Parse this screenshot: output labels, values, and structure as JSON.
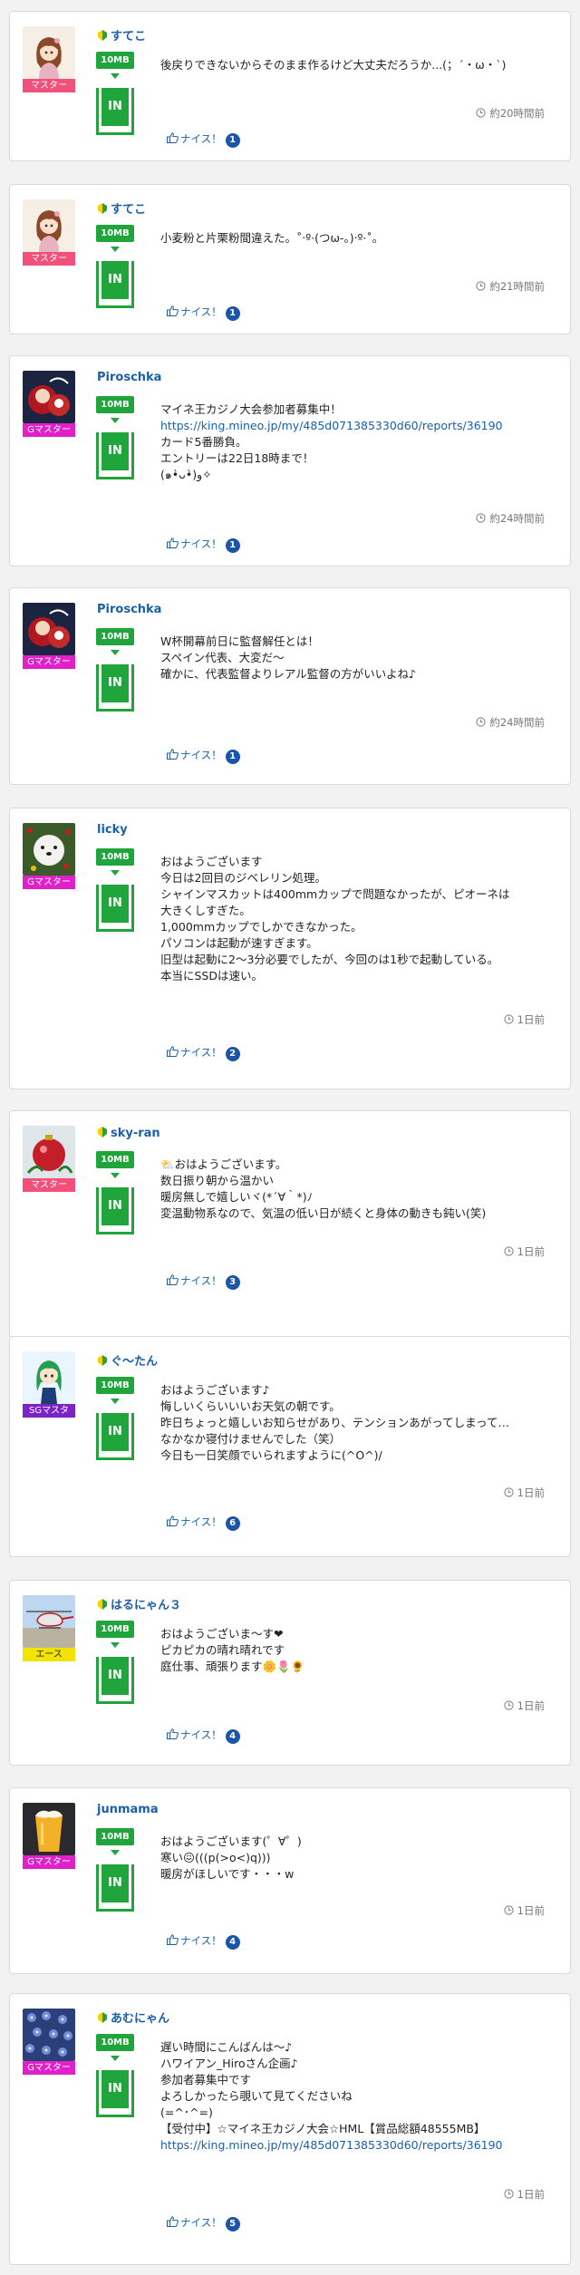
{
  "colors": {
    "accent_green": "#1fa53b",
    "link_blue": "#1a5fa8",
    "badge_blue": "#1a56a8",
    "rank_master": "#f0507a",
    "rank_gmaster": "#e020c8",
    "rank_sgmaster": "#7a24c8",
    "rank_ace": "#f2e400"
  },
  "common": {
    "mb_label": "10MB",
    "in_label": "IN",
    "nice_label": "ナイス！"
  },
  "posts": [
    {
      "user": "すてこ",
      "beginner": true,
      "rank": "マスター",
      "rank_color": "#f0507a",
      "avatar": "girl-illustration",
      "lines": [
        "後戻りできないからそのまま作るけど大丈夫だろうか...(；´・ω・`)"
      ],
      "time": "約20時間前",
      "nice_count": "1"
    },
    {
      "user": "すてこ",
      "beginner": true,
      "rank": "マスター",
      "rank_color": "#f0507a",
      "avatar": "girl-illustration",
      "lines": [
        "小麦粉と片栗粉間違えた。˚‧º·(つω-｡)‧º·˚。"
      ],
      "time": "約21時間前",
      "nice_count": "1"
    },
    {
      "user": "Piroschka",
      "beginner": false,
      "rank": "Gマスター",
      "rank_color": "#e020c8",
      "avatar": "red-character",
      "lines": [
        "マイネ王カジノ大会参加者募集中！",
        "https://king.mineo.jp/my/485d071385330d60/reports/36190",
        "カード5番勝負。",
        "エントリーは22日18時まで！",
        "(๑•̀ᴗ•̀)ﻭ✧"
      ],
      "link_index": 1,
      "time": "約24時間前",
      "nice_count": "1"
    },
    {
      "user": "Piroschka",
      "beginner": false,
      "rank": "Gマスター",
      "rank_color": "#e020c8",
      "avatar": "red-character",
      "lines": [
        "W杯開幕前日に監督解任とは！",
        "スペイン代表、大変だ〜",
        "確かに、代表監督よりレアル監督の方がいいよね♪"
      ],
      "time": "約24時間前",
      "nice_count": "1"
    },
    {
      "user": "licky",
      "beginner": false,
      "rank": "Gマスター",
      "rank_color": "#e020c8",
      "avatar": "white-dog",
      "lines": [
        "おはようございます",
        "今日は2回目のジベレリン処理。",
        "シャインマスカットは400mmカップで問題なかったが、ピオーネは",
        "大きくしすぎた。",
        "1,000mmカップでしかできなかった。",
        "パソコンは起動が速すぎます。",
        "旧型は起動に2～3分必要でしたが、今回のは1秒で起動している。",
        "本当にSSDは速い。"
      ],
      "time": "1日前",
      "nice_count": "2"
    },
    {
      "user": "sky-ran",
      "beginner": true,
      "rank": "マスター",
      "rank_color": "#f0507a",
      "avatar": "christmas-ornament",
      "lines": [
        "⛅おはようございます。",
        "数日振り朝から温かい",
        "暖房無しで嬉しいヾ(*´∀｀*)ﾉ",
        "変温動物系なので、気温の低い日が続くと身体の動きも鈍い(笑)"
      ],
      "time": "1日前",
      "nice_count": "3"
    },
    {
      "user": "ぐ〜たん",
      "beginner": true,
      "rank": "SGマスタ",
      "rank_color": "#7a24c8",
      "avatar": "green-hair-girl",
      "lines": [
        "おはようございます♪",
        "悔しいくらいいいお天気の朝です。",
        "昨日ちょっと嬉しいお知らせがあり、テンションあがってしまって…",
        "なかなか寝付けませんでした（笑）",
        "今日も一日笑顔でいられますように(^O^)/"
      ],
      "time": "1日前",
      "nice_count": "6"
    },
    {
      "user": "はるにゃん３",
      "beginner": true,
      "rank": "エース",
      "rank_color": "#f2e400",
      "rank_text_color": "#222",
      "avatar": "helicopter",
      "lines": [
        "おはようございま〜す❤",
        "ピカピカの晴れ晴れです",
        "庭仕事、頑張ります🌼🌷🌻"
      ],
      "time": "1日前",
      "nice_count": "4"
    },
    {
      "user": "junmama",
      "beginner": false,
      "rank": "Gマスター",
      "rank_color": "#e020c8",
      "avatar": "beer-glass",
      "lines": [
        "おはようございます(゜∀゜)",
        "寒い😖(((p(>o<)q)))",
        "暖房がほしいです・・・w"
      ],
      "time": "1日前",
      "nice_count": "4"
    },
    {
      "user": "あむにゃん",
      "beginner": true,
      "rank": "Gマスター",
      "rank_color": "#e020c8",
      "avatar": "blue-flowers",
      "lines": [
        "遅い時間にこんばんは〜♪",
        "ハワイアン_Hiroさん企画♪",
        "参加者募集中です",
        "よろしかったら覗いて見てくださいね",
        "(=^･^=)",
        "【受付中】☆マイネ王カジノ大会☆HML【賞品総額48555MB】",
        "https://king.mineo.jp/my/485d071385330d60/reports/36190"
      ],
      "link_index": 6,
      "time": "1日前",
      "nice_count": "5"
    }
  ]
}
